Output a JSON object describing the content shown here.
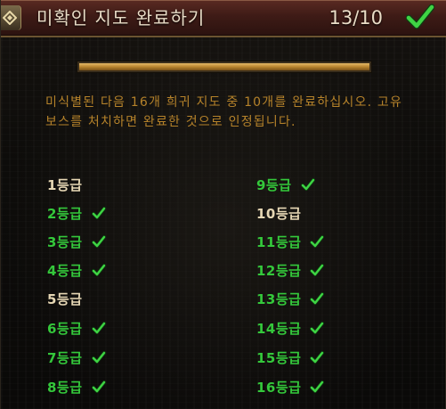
{
  "header": {
    "title": "미확인 지도 완료하기",
    "progress_text": "13/10"
  },
  "progress": {
    "fraction": 1.0
  },
  "description": "미식별된 다음 16개 희귀 지도 중 10개를 완료하십시오. 고유 보스를 처치하면 완료한 것으로 인정됩니다.",
  "tiers": [
    {
      "label": "1등급",
      "completed": false
    },
    {
      "label": "2등급",
      "completed": true
    },
    {
      "label": "3등급",
      "completed": true
    },
    {
      "label": "4등급",
      "completed": true
    },
    {
      "label": "5등급",
      "completed": false
    },
    {
      "label": "6등급",
      "completed": true
    },
    {
      "label": "7등급",
      "completed": true
    },
    {
      "label": "8등급",
      "completed": true
    },
    {
      "label": "9등급",
      "completed": true
    },
    {
      "label": "10등급",
      "completed": false
    },
    {
      "label": "11등급",
      "completed": true
    },
    {
      "label": "12등급",
      "completed": true
    },
    {
      "label": "13등급",
      "completed": true
    },
    {
      "label": "14등급",
      "completed": true
    },
    {
      "label": "15등급",
      "completed": true
    },
    {
      "label": "16등급",
      "completed": true
    }
  ],
  "colors": {
    "completed": "#34c83b",
    "pending": "#e6d7b4",
    "description": "#b5822a",
    "header_bg": "#3e1b16"
  },
  "icons": {
    "header_check": "check-icon",
    "tier_check": "check-icon",
    "corner": "ornament-icon"
  }
}
